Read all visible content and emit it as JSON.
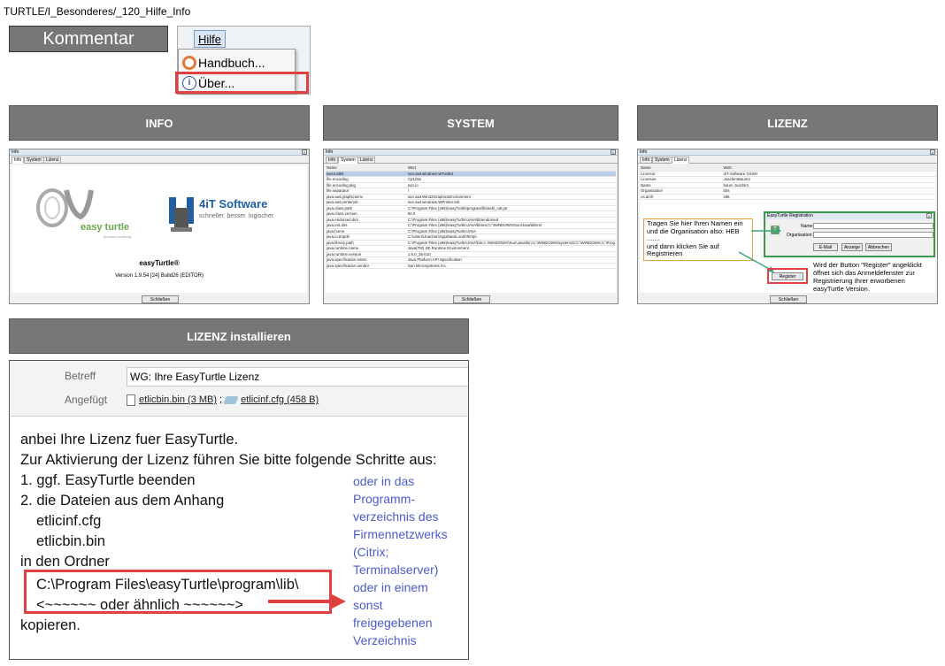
{
  "breadcrumb": "TURTLE/I_Besonderes/_120_Hilfe_Info",
  "kommentar_label": "Kommentar",
  "menu": {
    "title": "Hilfe",
    "items": [
      {
        "label": "Handbuch..."
      },
      {
        "label": "Über..."
      }
    ]
  },
  "sections": {
    "info": "INFO",
    "system": "SYSTEM",
    "lizenz": "LIZENZ",
    "lizenz_install": "LIZENZ installieren"
  },
  "info_window": {
    "title": "Info",
    "tabs": [
      "Info",
      "System",
      "Lizenz"
    ],
    "brand_left": "easy turtle",
    "brand_left_sub": "process modeling",
    "brand_right": "4iT Software",
    "brand_right_sub": "schneller. besser. logischer.",
    "product": "easyTurtle®",
    "version": "Version 1.9.54 [24] Build26 (EDITOR)",
    "close_label": "Schließen"
  },
  "system_window": {
    "title": "Info",
    "tabs": [
      "Info",
      "System",
      "Lizenz"
    ],
    "columns": [
      "Name",
      "Wert"
    ],
    "rows": [
      [
        "awt.toolkit",
        "sun.awt.windows.WToolkit"
      ],
      [
        "file.encoding",
        "Cp1252"
      ],
      [
        "file.encoding.pkg",
        "sun.io"
      ],
      [
        "file.separator",
        "\\"
      ],
      [
        "java.awt.graphicsenv",
        "sun.awt.Win32GraphicsEnvironment"
      ],
      [
        "java.awt.printerjob",
        "sun.awt.windows.WPrinterJob"
      ],
      [
        "java.class.path",
        "C:\\Program Files (x86)\\easyTurtle\\program\\lib\\asbl_cat.jar"
      ],
      [
        "java.class.version",
        "50.0"
      ],
      [
        "java.endorsed.dirs",
        "C:\\Program Files (x86)\\easyTurtle\\JAVA\\lib\\endorsed"
      ],
      [
        "java.ext.dirs",
        "C:\\Program Files (x86)\\easyTurtle\\JAVA\\lib\\ext;C:\\WINDOWS\\Sun\\Java\\lib\\ext"
      ],
      [
        "java.home",
        "C:\\Program Files (x86)\\easyTurtle\\JAVA"
      ],
      [
        "java.io.tmpdir",
        "C:\\Users\\Joachim\\AppData\\Local\\Temp\\"
      ],
      [
        "java.library.path",
        "C:\\Program Files (x86)\\easyTurtle\\JAVA\\bin;C:\\WINDOWS\\Sun\\Java\\bin;C:\\WINDOWS\\system32;C:\\WINDOWS;C:\\Prog"
      ],
      [
        "java.runtime.name",
        "Java(TM) SE Runtime Environment"
      ],
      [
        "java.runtime.version",
        "1.6.0_35-b10"
      ],
      [
        "java.specification.name",
        "Java Platform API Specification"
      ],
      [
        "java.specification.vendor",
        "Sun Microsystems Inc."
      ]
    ],
    "close_label": "Schließen"
  },
  "license_window": {
    "title": "Info",
    "tabs": [
      "Info",
      "System",
      "Lizenz"
    ],
    "columns": [
      "Name",
      "Wert"
    ],
    "rows": [
      [
        "Licensor",
        "4iT-Software GmbH"
      ],
      [
        "Licensee",
        "JoachimBaum4"
      ],
      [
        "Name",
        "baum Joachim"
      ],
      [
        "Organisation",
        "bbs"
      ],
      [
        "os.arch",
        "x86"
      ]
    ],
    "dialog_title": "EasyTurtle Registration",
    "name_label": "Name:",
    "org_label": "Organisation:",
    "btn_email": "E-Mail",
    "btn_anzeige": "Anzeige",
    "btn_abbrechen": "Abbrechen",
    "note_left": [
      "Tragen Sie hier Ihren Namen ein",
      "und die Organisation also: HEB",
      ".......",
      "und dann klicken Sie auf",
      "Registrieren"
    ],
    "note_right": [
      "Wird der Button \"Register\" angeklickt",
      "öffnet sich das Anmeldefenster zur",
      "Registrierung Ihrer erworbenen",
      "easyTurtle Version."
    ],
    "register_label": "Register",
    "close_label": "Schließen"
  },
  "mail": {
    "subject_label": "Betreff",
    "subject": "WG: Ihre EasyTurtle Lizenz",
    "attached_label": "Angefügt",
    "attachments": [
      {
        "name": "etlicbin.bin (3 MB)"
      },
      {
        "name": "etlicinf.cfg (458 B)"
      }
    ],
    "lines": [
      "anbei Ihre Lizenz fuer EasyTurtle.",
      "Zur Aktivierung der Lizenz führen Sie bitte folgende Schritte aus:",
      "1. ggf. EasyTurtle beenden",
      "2. die Dateien aus dem Anhang",
      "etlicinf.cfg",
      "etlicbin.bin",
      "in den Ordner",
      "C:\\Program Files\\easyTurtle\\program\\lib\\",
      "<~~~~~~ oder ähnlich ~~~~~~>",
      "kopieren."
    ],
    "note_lines": [
      "oder in das",
      "Programm-",
      "verzeichnis des",
      "Firmennetzwerks",
      "(Citrix;",
      "Terminalserver)",
      "oder in einem",
      "sonst",
      "freigegebenen",
      "Verzeichnis"
    ]
  },
  "colors": {
    "section_bar": "#777777",
    "highlight_red": "#e04040",
    "note_blue": "#4a5cc8",
    "dialog_green": "#3a9a4a",
    "note_orange": "#e8a33c"
  }
}
